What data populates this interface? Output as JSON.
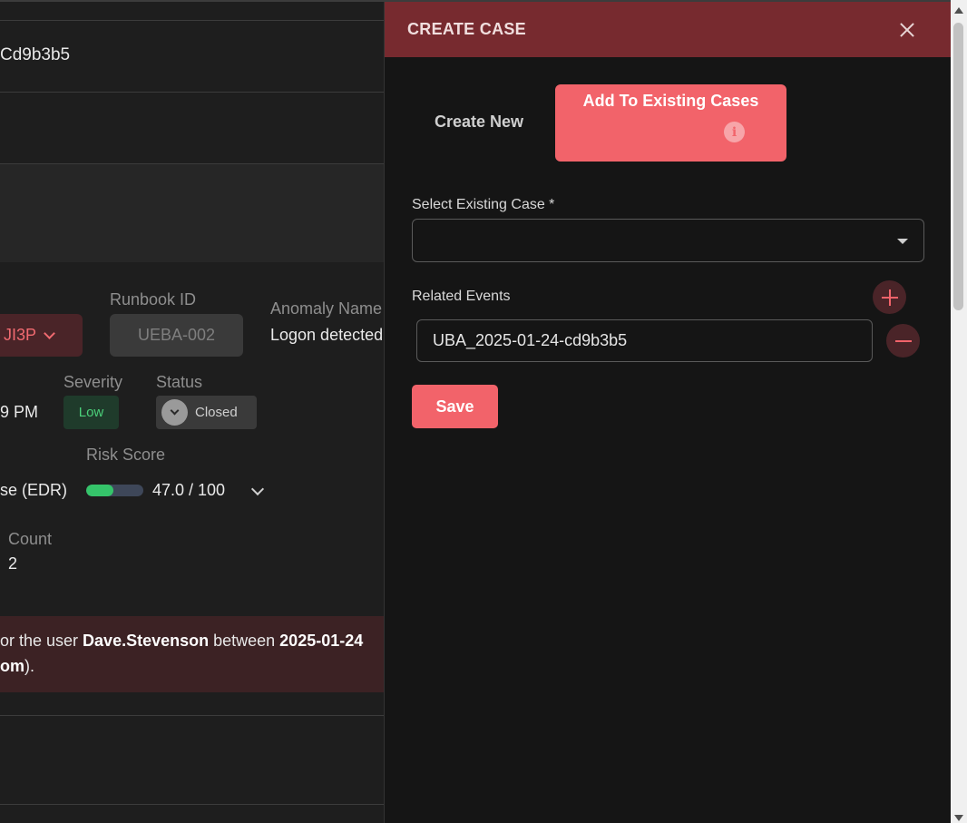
{
  "background": {
    "event_id_partial": "Cd9b3b5",
    "owner_partial": "JI3P",
    "runbook": {
      "label": "Runbook ID",
      "value": "UEBA-002"
    },
    "anomaly": {
      "label": "Anomaly Name",
      "value": "Logon detected"
    },
    "time_partial": "9 PM",
    "severity": {
      "label": "Severity",
      "value": "Low"
    },
    "status": {
      "label": "Status",
      "value": "Closed"
    },
    "source_partial": "se (EDR)",
    "risk": {
      "label": "Risk Score",
      "value": "47.0 / 100",
      "fraction": 0.47
    },
    "count": {
      "label": "Count",
      "value": "2"
    },
    "description": {
      "line1_prefix": "or the user ",
      "line1_user": "Dave.Stevenson",
      "line1_middle": " between ",
      "line1_date": "2025-01-24",
      "line2_bold": "om",
      "line2_suffix": ")."
    }
  },
  "modal": {
    "title": "CREATE CASE",
    "tabs": {
      "create_new": "Create New",
      "add_existing": "Add To Existing Cases"
    },
    "info_glyph": "i",
    "select_label": "Select Existing Case  *",
    "select_value": "",
    "related_label": "Related Events",
    "related_events": [
      "UBA_2025-01-24-cd9b3b5"
    ],
    "save_label": "Save"
  },
  "colors": {
    "accent": "#f2636a",
    "header": "#772a2f",
    "severity_low": "#4bd07a",
    "risk_fill": "#35c46a"
  },
  "icons": [
    "close-icon",
    "info-icon",
    "chevron-down-icon",
    "plus-icon",
    "minus-icon",
    "caret-down-icon"
  ]
}
